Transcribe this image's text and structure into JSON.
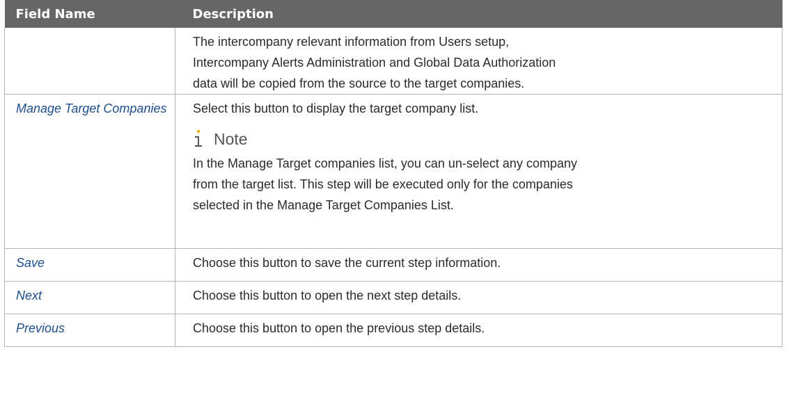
{
  "table": {
    "headers": {
      "field_name": "Field Name",
      "description": "Description"
    },
    "rows": [
      {
        "field": "",
        "description_lines": [
          "The intercompany relevant information from Users setup,",
          "Intercompany Alerts Administration and Global Data Authorization",
          "data will be copied from the source to the target companies."
        ]
      },
      {
        "field": "Manage Target Companies",
        "description": "Select this button to display the target company list.",
        "note": {
          "label": "Note",
          "icon": "info-icon",
          "lines": [
            "In the Manage Target companies list, you can un-select any company",
            "from the target list. This step will be executed only for the companies",
            "selected in the Manage Target Companies List."
          ]
        }
      },
      {
        "field": "Save",
        "description": "Choose this button to save the current step information."
      },
      {
        "field": "Next",
        "description": "Choose this button to open the next step details."
      },
      {
        "field": "Previous",
        "description": "Choose this button to open the previous step details."
      }
    ]
  },
  "colors": {
    "header_bg": "#666666",
    "field_text": "#1f4e8c",
    "note_accent": "#f0ab00",
    "border": "#b3b3b3"
  }
}
